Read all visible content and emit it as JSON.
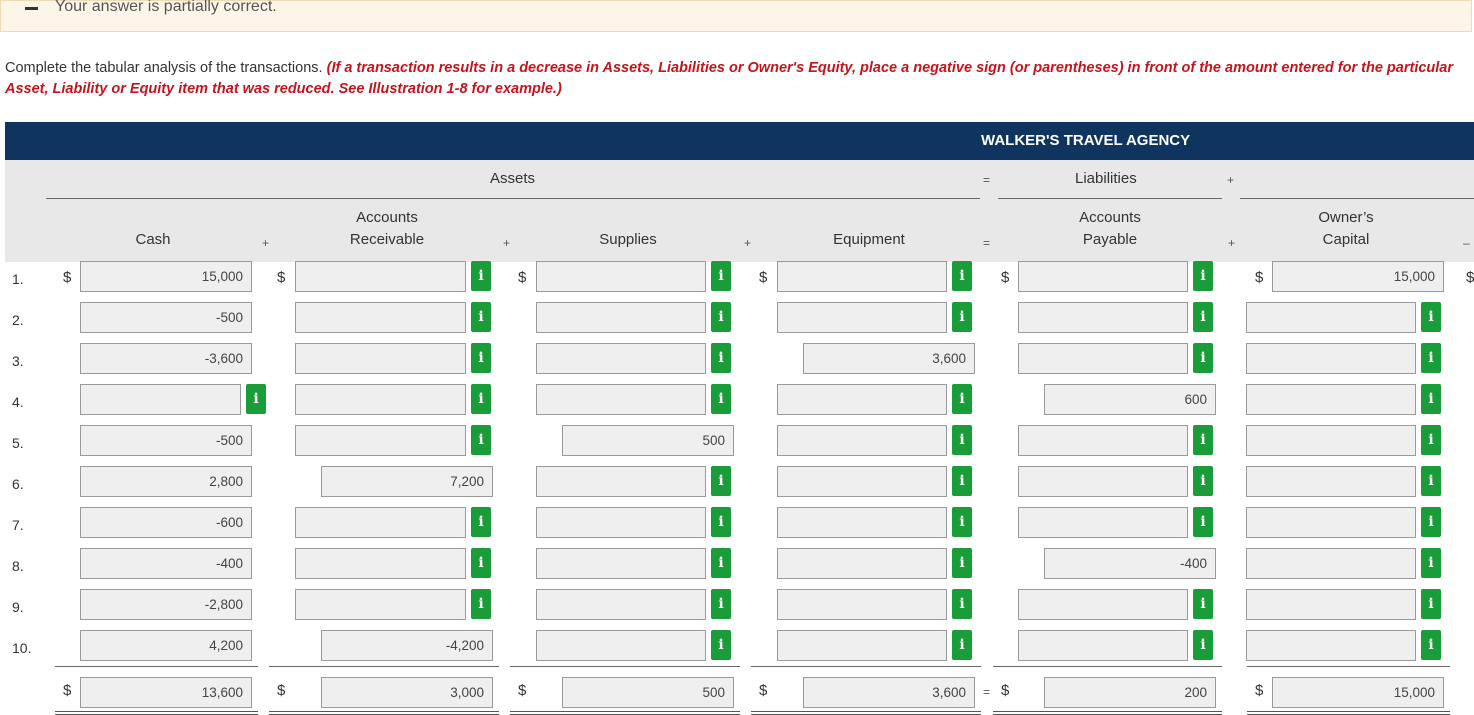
{
  "banner": {
    "message": "Your answer is partially correct."
  },
  "instructions": {
    "lead": "Complete the tabular analysis of the transactions.",
    "emphasis": "(If a transaction results in a decrease in Assets, Liabilities or Owner's Equity, place a negative sign (or parentheses) in front of the amount entered for the particular Asset, Liability or Equity item that was reduced. See Illustration 1-8 for example.)"
  },
  "table": {
    "title": "WALKER'S TRAVEL AGENCY",
    "assets_label": "Assets",
    "liabilities_label": "Liabilities",
    "equals": "=",
    "plus": "+",
    "minus": "–",
    "currency": "$",
    "info_button": "i",
    "columns": [
      {
        "line1": "",
        "line2": "Cash"
      },
      {
        "line1": "Accounts",
        "line2": "Receivable"
      },
      {
        "line1": "",
        "line2": "Supplies"
      },
      {
        "line1": "",
        "line2": "Equipment"
      },
      {
        "line1": "Accounts",
        "line2": "Payable"
      },
      {
        "line1": "Owner’s",
        "line2": "Capital"
      }
    ],
    "rows": [
      {
        "num": "1.",
        "values": [
          "15,000",
          "",
          "",
          "",
          "",
          "15,000"
        ]
      },
      {
        "num": "2.",
        "values": [
          "-500",
          "",
          "",
          "",
          "",
          ""
        ]
      },
      {
        "num": "3.",
        "values": [
          "-3,600",
          "",
          "",
          "3,600",
          "",
          ""
        ]
      },
      {
        "num": "4.",
        "values": [
          "",
          "",
          "",
          "",
          "600",
          ""
        ]
      },
      {
        "num": "5.",
        "values": [
          "-500",
          "",
          "500",
          "",
          "",
          ""
        ]
      },
      {
        "num": "6.",
        "values": [
          "2,800",
          "7,200",
          "",
          "",
          "",
          ""
        ]
      },
      {
        "num": "7.",
        "values": [
          "-600",
          "",
          "",
          "",
          "",
          ""
        ]
      },
      {
        "num": "8.",
        "values": [
          "-400",
          "",
          "",
          "",
          "-400",
          ""
        ]
      },
      {
        "num": "9.",
        "values": [
          "-2,800",
          "",
          "",
          "",
          "",
          ""
        ]
      },
      {
        "num": "10.",
        "values": [
          "4,200",
          "-4,200",
          "",
          "",
          "",
          ""
        ]
      }
    ],
    "totals": [
      "13,600",
      "3,000",
      "500",
      "3,600",
      "200",
      "15,000"
    ]
  }
}
